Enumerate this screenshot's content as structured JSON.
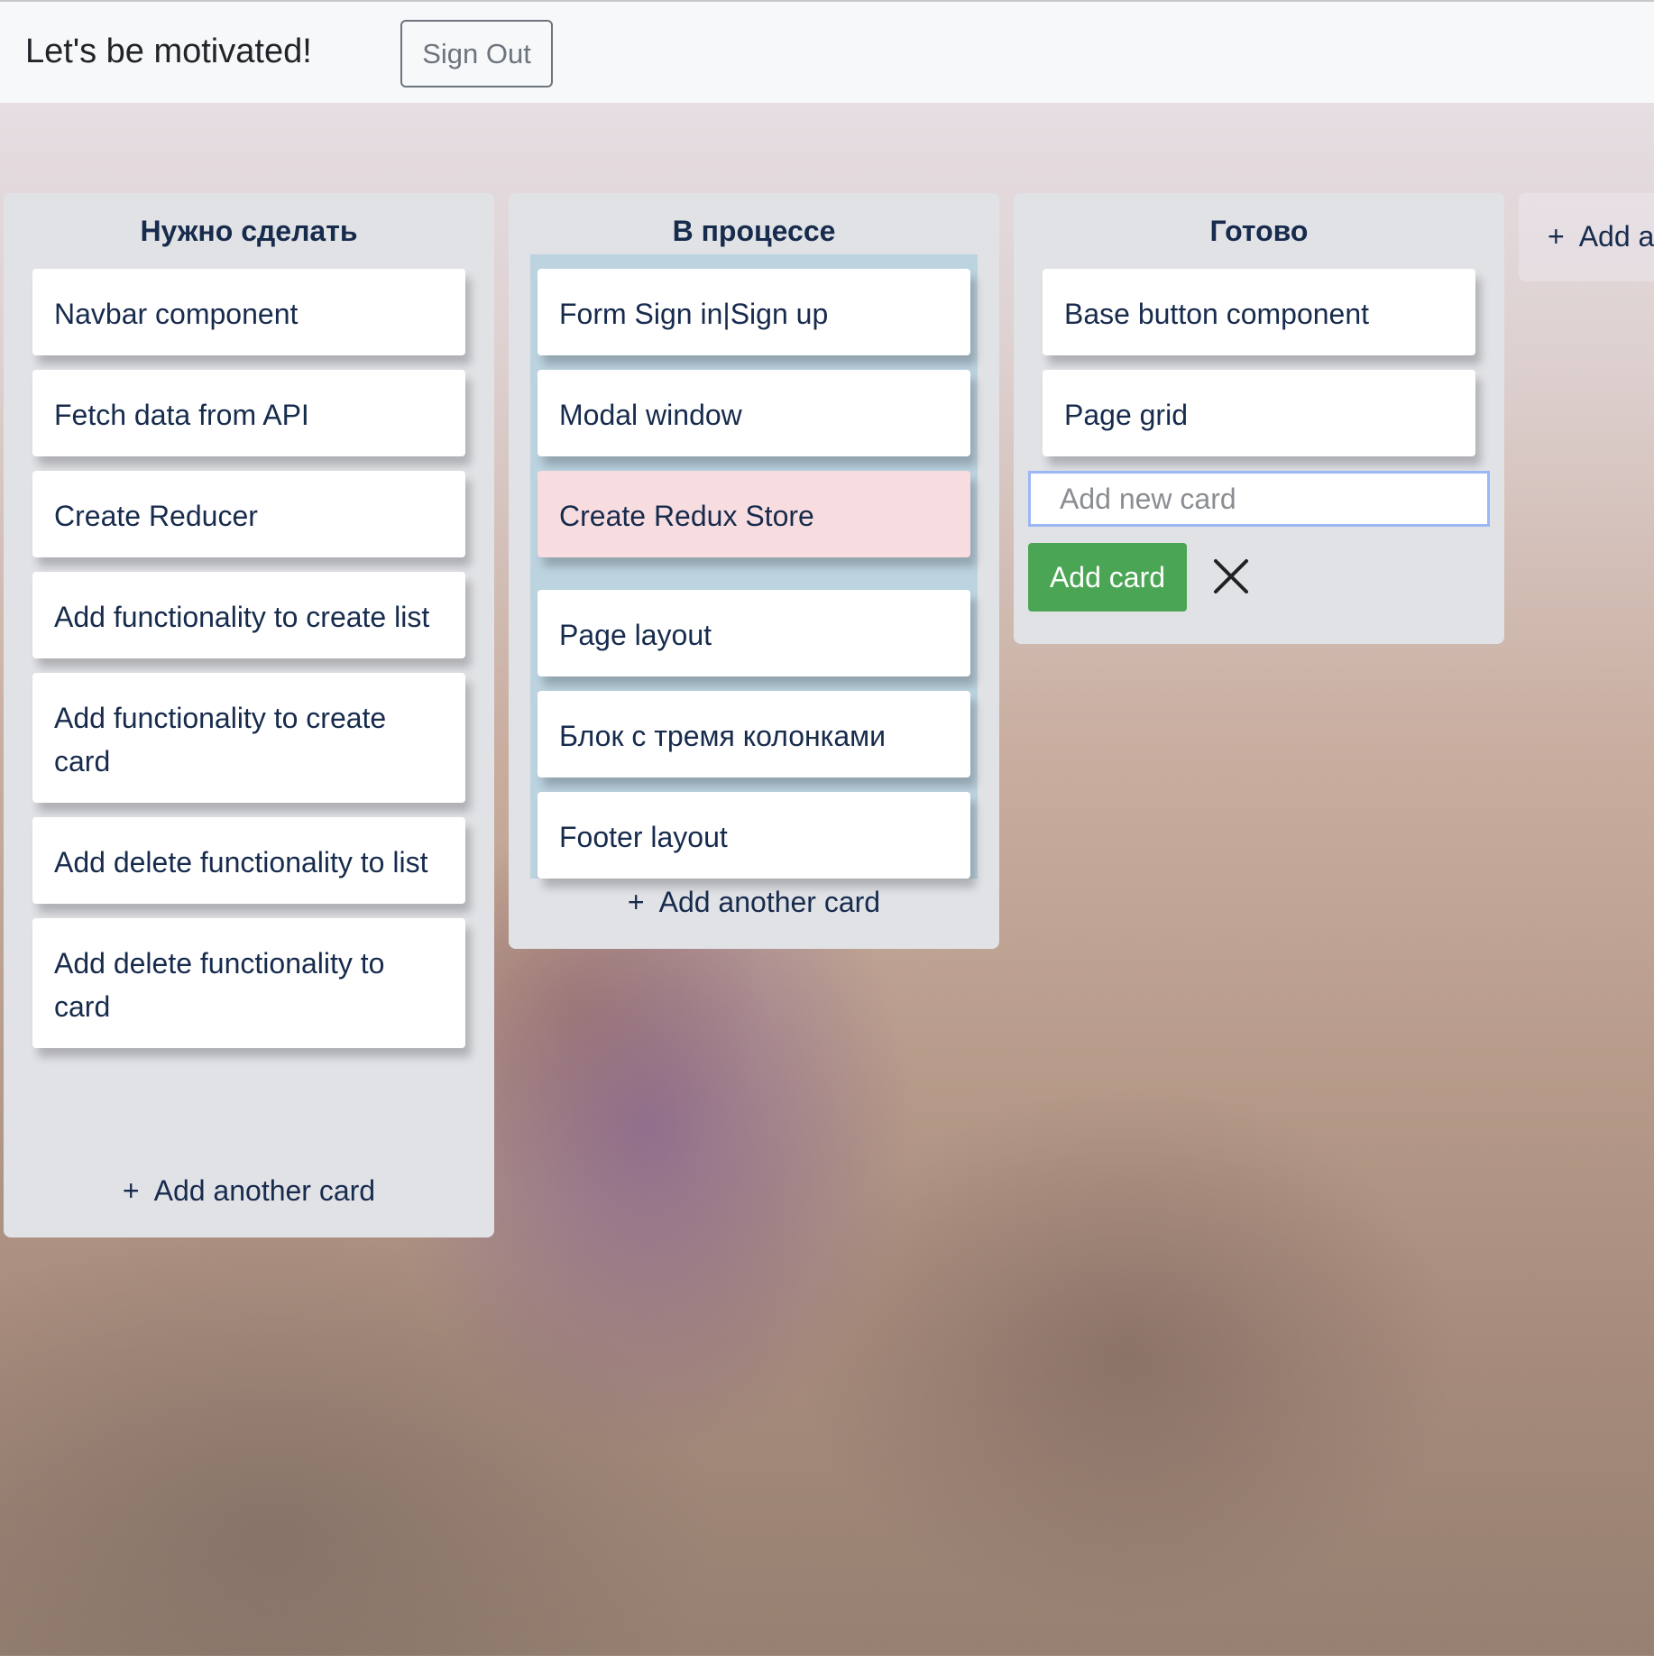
{
  "navbar": {
    "brand": "Let's be motivated!",
    "sign_out_label": "Sign Out"
  },
  "lists": [
    {
      "title": "Нужно сделать",
      "cards": [
        "Navbar component",
        "Fetch data from API",
        "Create Reducer",
        "Add functionality to create list",
        "Add functionality to create card",
        "Add delete functionality to list",
        "Add delete functionality to card"
      ],
      "add_another_label": "Add another card"
    },
    {
      "title": "В процессе",
      "cards": [
        "Form Sign in|Sign up",
        "Modal window",
        "Create Redux Store",
        "Page layout",
        "Блок с тремя колонками",
        "Footer layout"
      ],
      "add_another_label": "Add another card"
    },
    {
      "title": "Готово",
      "cards": [
        "Base button component",
        "Page grid"
      ],
      "new_card_placeholder": "Add new card",
      "add_card_label": "Add card"
    }
  ],
  "add_list": {
    "label": "Add a"
  },
  "icons": {
    "plus": "+",
    "close": "close-icon"
  },
  "colors": {
    "add_card_button": "#4aa654",
    "dragging_card": "#f8dde0",
    "drop_zone": "#bcd3e0",
    "list_background": "#e1e2e6"
  }
}
